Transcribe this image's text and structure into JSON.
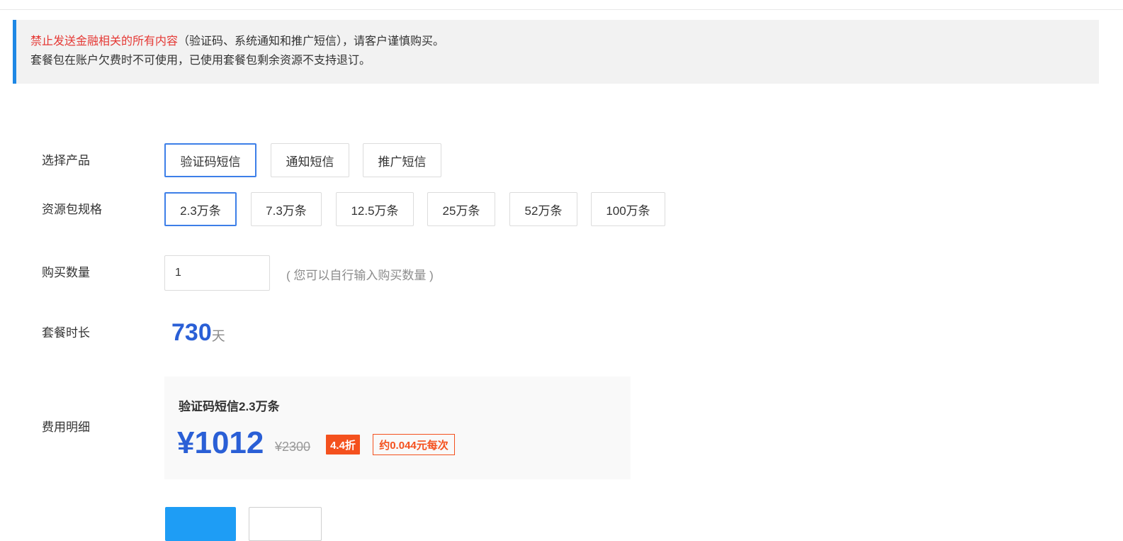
{
  "notice": {
    "warning_text": "禁止发送金融相关的所有内容",
    "warning_suffix": "（验证码、系统通知和推广短信），请客户谨慎购买。",
    "line2": "套餐包在账户欠费时不可使用，已使用套餐包剩余资源不支持退订。"
  },
  "product": {
    "label": "选择产品",
    "options": [
      "验证码短信",
      "通知短信",
      "推广短信"
    ],
    "selected": "验证码短信"
  },
  "package_size": {
    "label": "资源包规格",
    "options": [
      "2.3万条",
      "7.3万条",
      "12.5万条",
      "25万条",
      "52万条",
      "100万条"
    ],
    "selected": "2.3万条"
  },
  "quantity": {
    "label": "购买数量",
    "value": "1",
    "hint": "( 您可以自行输入购买数量 )"
  },
  "duration": {
    "label": "套餐时长",
    "value": "730",
    "unit": "天"
  },
  "cost": {
    "label": "费用明细",
    "title": "验证码短信2.3万条",
    "price": "¥1012",
    "original_price": "¥2300",
    "discount": "4.4折",
    "per_unit": "约0.044元每次"
  },
  "colors": {
    "accent_blue": "#2a5fd6",
    "notice_bar": "#1e88e5",
    "warning_red": "#e53935",
    "badge_orange": "#f4511e",
    "button_blue": "#1e9df5"
  }
}
